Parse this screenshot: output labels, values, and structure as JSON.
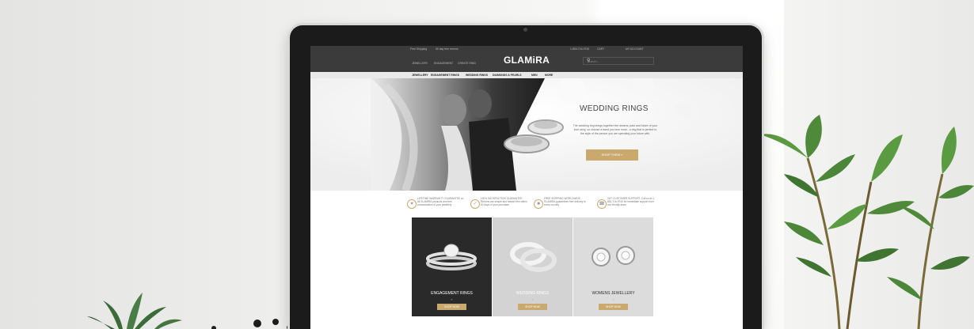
{
  "site": {
    "logo": "GLAMiRA",
    "topbar_left": [
      "Free Shipping",
      "60 day free returns"
    ],
    "topbar_right": [
      "1-800-716-9740",
      "CART",
      "MY ACCOUNT"
    ],
    "sub_links": [
      "JEWELLERY",
      "ENGAGEMENT",
      "CREATE RING"
    ],
    "search_placeholder": "Search...",
    "nav": [
      "JEWELLERY",
      "ENGAGEMENT RINGS",
      "WEDDING RINGS",
      "DIAMONDS & PEARLS",
      "MEN",
      "MORE"
    ]
  },
  "hero": {
    "title": "WEDDING RINGS",
    "text": "The wedding ring brings together the dreams, past and future of your love story, so choose a band you love most - a ring that is perfect to the style of the person you are spending your future with.",
    "button": "SHOP THEM »"
  },
  "features": [
    {
      "icon": "gift-icon",
      "text": "LIFETIME WARRANTY GUARANTEE on all GLAMIRA products and free customisation of your jewellery"
    },
    {
      "icon": "check-icon",
      "text": "100% SATISFACTION GUARANTEE. Returns are simple and hassle-free within 60 days of your purchase"
    },
    {
      "icon": "truck-icon",
      "text": "FREE SHIPPING WORLDWIDE. GLAMIRA guarantees free delivery to every country"
    },
    {
      "icon": "headset-icon",
      "text": "24/7 CUSTOMER SUPPORT. Call us at 1-800-716-9740 for immediate support from our friendly team"
    }
  ],
  "tiles": [
    {
      "label": "ENGAGEMENT RINGS",
      "button": "SHOP NOW"
    },
    {
      "label": "WEDDING RINGS",
      "button": "SHOP NOW"
    },
    {
      "label": "WOMENS JEWELLERY",
      "button": "SHOP NOW"
    }
  ],
  "colors": {
    "accent": "#c9a96e",
    "header": "#3b3b3b"
  }
}
